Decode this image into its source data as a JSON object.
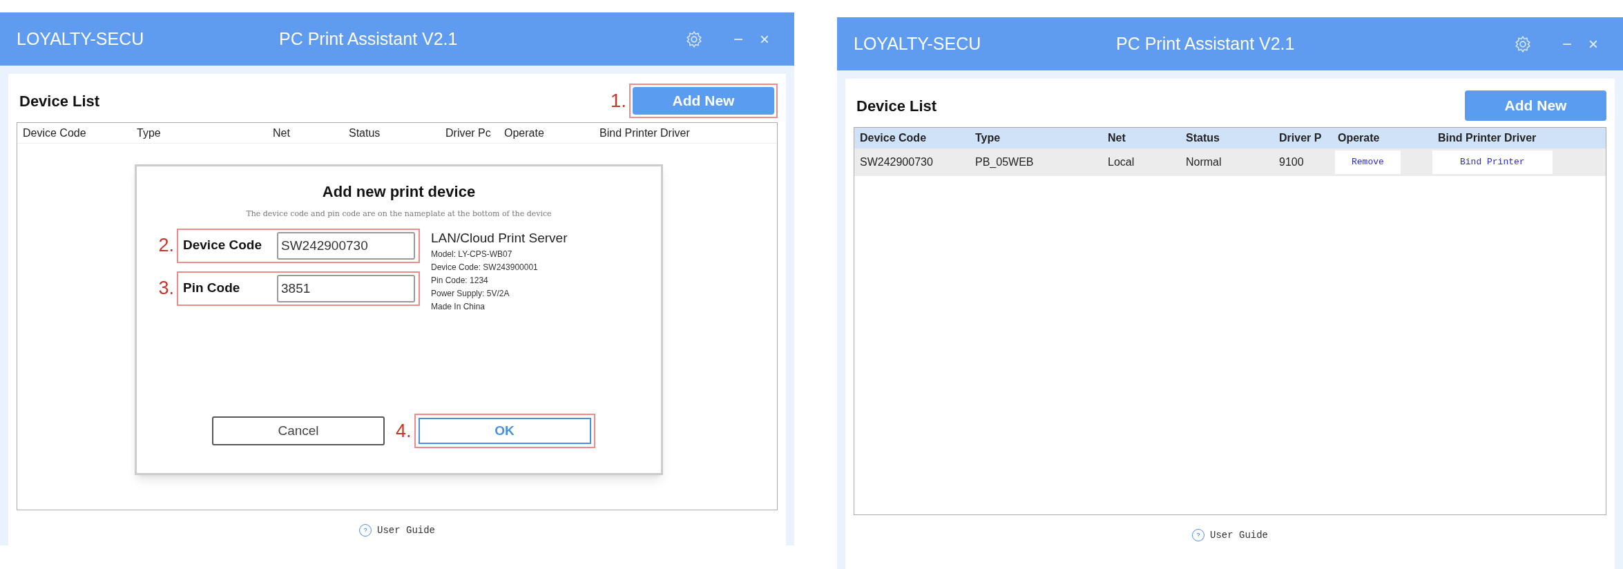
{
  "windows": [
    {
      "brand": "LOYALTY-SECU",
      "title": "PC Print Assistant V2.1",
      "controls": [
        "−",
        "×"
      ],
      "section_title": "Device List",
      "add_button": {
        "label": "Add New",
        "annotation": "1."
      },
      "table": {
        "header_highlighted": false,
        "columns": [
          "Device Code",
          "Type",
          "Net",
          "Status",
          "Driver Pc",
          "Operate",
          "Bind Printer Driver"
        ]
      },
      "dialog": {
        "title": "Add new print device",
        "hint": "The device code and pin code are on the nameplate at the bottom of the device",
        "fields": [
          {
            "label": "Device Code",
            "value": "SW242900730",
            "annotation": "2."
          },
          {
            "label": "Pin Code",
            "value": "3851",
            "annotation": "3."
          }
        ],
        "info": {
          "title": "LAN/Cloud Print Server",
          "lines": [
            "Model: LY-CPS-WB07",
            "Device Code: SW243900001",
            "Pin Code: 1234",
            "Power Supply: 5V/2A",
            "Made In China"
          ]
        },
        "buttons": [
          {
            "label": "Cancel",
            "kind": "secondary"
          },
          {
            "label": "OK",
            "kind": "primary",
            "annotation": "4."
          }
        ]
      },
      "user_guide": "User Guide"
    },
    {
      "brand": "LOYALTY-SECU",
      "title": "PC Print Assistant V2.1",
      "controls": [
        "−",
        "×"
      ],
      "section_title": "Device List",
      "add_button": {
        "label": "Add New"
      },
      "table": {
        "header_highlighted": true,
        "columns": [
          "Device Code",
          "Type",
          "Net",
          "Status",
          "Driver P",
          "Operate",
          "Bind Printer Driver"
        ],
        "rows": [
          {
            "selected": true,
            "cells": [
              "SW242900730",
              "PB_05WEB",
              "Local",
              "Normal",
              "9100"
            ],
            "operate": "Remove",
            "bind": "Bind Printer"
          }
        ]
      },
      "user_guide": "User Guide"
    }
  ]
}
